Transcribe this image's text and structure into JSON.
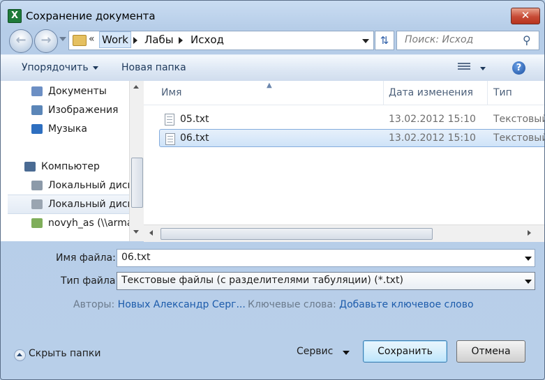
{
  "window": {
    "title": "Сохранение документа",
    "close_label": "✕",
    "app_icon_label": "X"
  },
  "nav": {
    "back_icon": "back-arrow-icon",
    "forward_icon": "forward-arrow-icon",
    "chevrons": "«",
    "breadcrumbs": [
      "Work",
      "Лабы",
      "Исход"
    ],
    "search_placeholder": "Поиск: Исход"
  },
  "toolbar": {
    "organize_label": "Упорядочить",
    "new_folder_label": "Новая папка",
    "help_label": "?"
  },
  "sidebar": {
    "items": [
      {
        "label": "Документы",
        "icon": "documents-icon",
        "color": "#6c8fc4"
      },
      {
        "label": "Изображения",
        "icon": "pictures-icon",
        "color": "#5b86b8"
      },
      {
        "label": "Музыка",
        "icon": "music-icon",
        "color": "#2e6fc0"
      },
      {
        "label": "Компьютер",
        "icon": "computer-icon",
        "color": "#4a6b93"
      },
      {
        "label": "Локальный диск (C:)",
        "icon": "drive-windows-icon",
        "color": "#8c9aa9"
      },
      {
        "label": "Локальный диск (D:)",
        "icon": "drive-icon",
        "color": "#9aa5b1"
      },
      {
        "label": "novyh_as (\\\\armada",
        "icon": "network-drive-icon",
        "color": "#7fae5a"
      }
    ]
  },
  "files": {
    "columns": {
      "name": "Имя",
      "date": "Дата изменения",
      "type": "Тип"
    },
    "rows": [
      {
        "name": "05.txt",
        "date": "13.02.2012 15:10",
        "type": "Текстовый документ"
      },
      {
        "name": "06.txt",
        "date": "13.02.2012 15:10",
        "type": "Текстовый документ"
      }
    ]
  },
  "form": {
    "filename_label": "Имя файла:",
    "filename_value": "06.txt",
    "filetype_label": "Тип файла:",
    "filetype_value": "Текстовые файлы (с разделителями табуляции) (*.txt)",
    "authors_label": "Авторы:",
    "authors_value": "Новых Александр Серг...",
    "keywords_label": "Ключевые слова:",
    "keywords_value": "Добавьте ключевое слово"
  },
  "footer": {
    "hide_folders_label": "Скрыть папки",
    "tools_label": "Сервис",
    "save_label": "Сохранить",
    "cancel_label": "Отмена"
  }
}
